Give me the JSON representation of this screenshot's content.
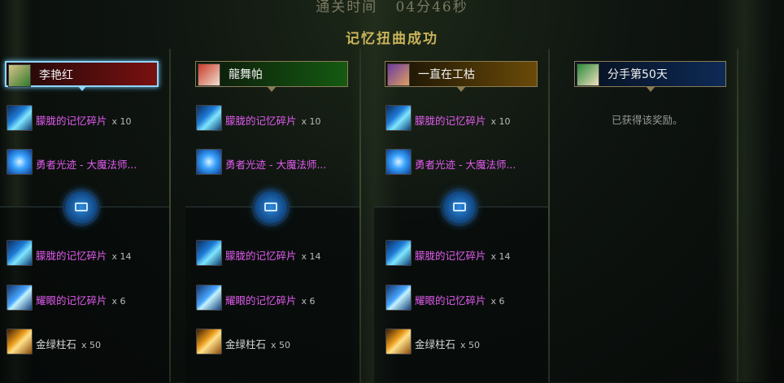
{
  "header": {
    "clear_time_label": "通关时间",
    "clear_time_value": "04分46秒",
    "result_text": "记忆扭曲成功"
  },
  "columns": [
    {
      "player_name": "李艳红",
      "frame_color": "#7a1010",
      "highlighted": true,
      "top_rewards": [
        {
          "icon": "memory-fragment-icon",
          "name": "朦胧的记忆碎片",
          "qty": "x 10"
        },
        {
          "icon": "mage-skill-icon",
          "name": "勇者光迹 - 大魔法师...",
          "qty": ""
        }
      ],
      "bottom_rewards": [
        {
          "icon": "memory-fragment-icon",
          "name": "朦胧的记忆碎片",
          "qty": "x 14"
        },
        {
          "icon": "bright-fragment-icon",
          "name": "耀眼的记忆碎片",
          "qty": "x 6"
        },
        {
          "icon": "gold-green-stone-icon",
          "name": "金绿柱石",
          "qty": "x 50"
        }
      ]
    },
    {
      "player_name": "龍舞帕",
      "frame_color": "#155a12",
      "highlighted": false,
      "top_rewards": [
        {
          "icon": "memory-fragment-icon",
          "name": "朦胧的记忆碎片",
          "qty": "x 10"
        },
        {
          "icon": "mage-skill-icon",
          "name": "勇者光迹 - 大魔法师...",
          "qty": ""
        }
      ],
      "bottom_rewards": [
        {
          "icon": "memory-fragment-icon",
          "name": "朦胧的记忆碎片",
          "qty": "x 14"
        },
        {
          "icon": "bright-fragment-icon",
          "name": "耀眼的记忆碎片",
          "qty": "x 6"
        },
        {
          "icon": "gold-green-stone-icon",
          "name": "金绿柱石",
          "qty": "x 50"
        }
      ]
    },
    {
      "player_name": "一直在工枯",
      "frame_color": "#6a4a08",
      "highlighted": false,
      "top_rewards": [
        {
          "icon": "memory-fragment-icon",
          "name": "朦胧的记忆碎片",
          "qty": "x 10"
        },
        {
          "icon": "mage-skill-icon",
          "name": "勇者光迹 - 大魔法师...",
          "qty": ""
        }
      ],
      "bottom_rewards": [
        {
          "icon": "memory-fragment-icon",
          "name": "朦胧的记忆碎片",
          "qty": "x 14"
        },
        {
          "icon": "bright-fragment-icon",
          "name": "耀眼的记忆碎片",
          "qty": "x 6"
        },
        {
          "icon": "gold-green-stone-icon",
          "name": "金绿柱石",
          "qty": "x 50"
        }
      ]
    },
    {
      "player_name": "分手第50天",
      "frame_color": "#0e2a55",
      "highlighted": false,
      "notice": "已获得该奖励。"
    }
  ]
}
